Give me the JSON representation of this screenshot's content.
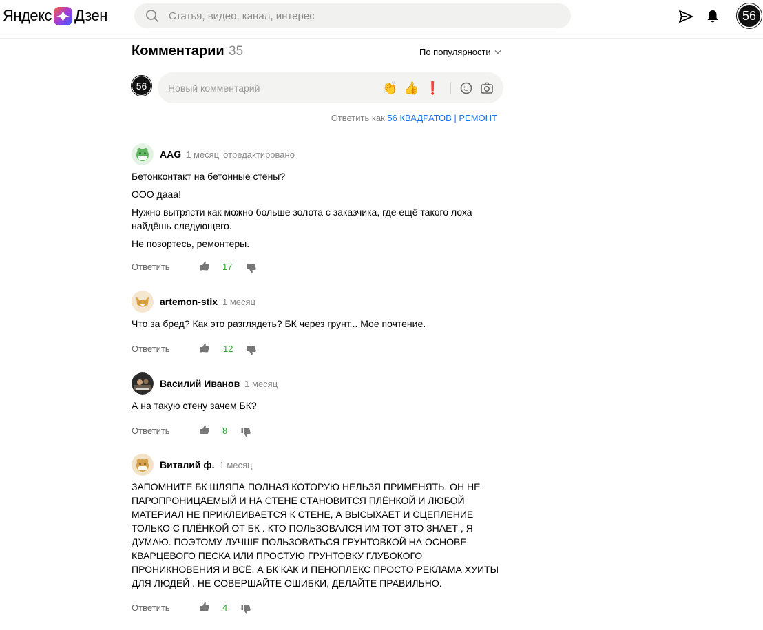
{
  "header": {
    "logo_ya": "Яндекс",
    "logo_dzen": "Дзен",
    "search_placeholder": "Статья, видео, канал, интерес",
    "avatar_label": "56"
  },
  "comments_section": {
    "title": "Комментарии",
    "count": "35",
    "sort_label": "По популярности",
    "new_comment_placeholder": "Новый комментарий",
    "my_avatar_label": "56",
    "reply_as_prefix": "Ответить как",
    "reply_as_name": "56 КВАДРАТОВ | РЕМОНТ",
    "reactions": [
      "👏",
      "👍",
      "❗"
    ]
  },
  "comments": [
    {
      "author": "AAG",
      "time": "1 месяц",
      "edited": "отредактировано",
      "paragraphs": [
        "Бетонконтакт на бетонные стены?",
        "ООО дааа!",
        "Нужно вытрясти как можно больше золота с заказчика, где ещё такого лоха найдёшь следующего.",
        "Не позортесь, ремонтеры."
      ],
      "reply_label": "Ответить",
      "likes": "17"
    },
    {
      "author": "artemon-stix",
      "time": "1 месяц",
      "paragraphs": [
        "Что за бред? Как это разглядеть? БК через грунт... Мое почтение."
      ],
      "reply_label": "Ответить",
      "likes": "12"
    },
    {
      "author": "Василий Иванов",
      "time": "1 месяц",
      "paragraphs": [
        "А на такую стену зачем БК?"
      ],
      "reply_label": "Ответить",
      "likes": "8"
    },
    {
      "author": "Виталий ф.",
      "time": "1 месяц",
      "paragraphs": [
        "ЗАПОМНИТЕ БК ШЛЯПА ПОЛНАЯ КОТОРУЮ НЕЛЬЗЯ ПРИМЕНЯТЬ. ОН НЕ ПАРОПРОНИЦАЕМЫЙ И НА СТЕНЕ СТАНОВИТСЯ ПЛЁНКОЙ И ЛЮБОЙ МАТЕРИАЛ НЕ ПРИКЛЕИВАЕТСЯ К СТЕНЕ, А ВЫСЫХАЕТ И СЦЕПЛЕНИЕ ТОЛЬКО С ПЛЁНКОЙ ОТ БК . КТО ПОЛЬЗОВАЛСЯ ИМ ТОТ ЭТО ЗНАЕТ , Я ДУМАЮ. ПОЭТОМУ ЛУЧШЕ ПОЛЬЗОВАТЬСЯ ГРУНТОВКОЙ НА ОСНОВЕ КВАРЦЕВОГО ПЕСКА ИЛИ ПРОСТУЮ ГРУНТОВКУ ГЛУБОКОГО ПРОНИКНОВЕНИЯ И ВСЁ. А БК КАК И ПЕНОПЛЕКС ПРОСТО РЕКЛАМА ХУИТЫ ДЛЯ ЛЮДЕЙ . НЕ СОВЕРШАЙТЕ ОШИБКИ, ДЕЛАЙТЕ ПРАВИЛЬНО."
      ],
      "reply_label": "Ответить",
      "likes": "4"
    }
  ],
  "colors": {
    "like_count": "#2ca52c",
    "link": "#1a73e8",
    "search_bg": "#f1f1ef"
  }
}
